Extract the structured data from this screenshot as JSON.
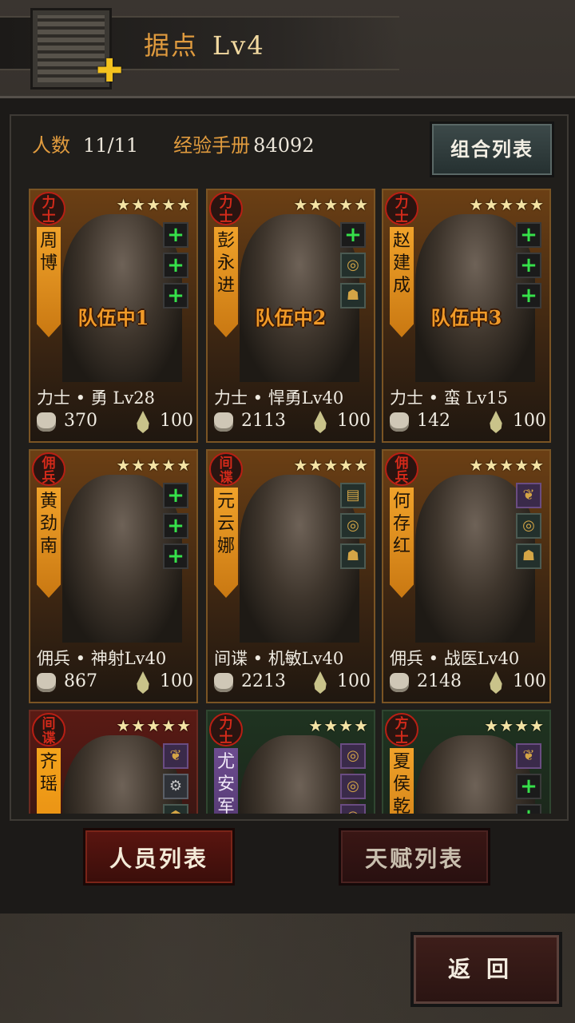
{
  "header": {
    "title": "据点",
    "level": "Lv4"
  },
  "stats": {
    "count_label": "人数",
    "count_value": "11/11",
    "exp_label": "经验手册",
    "exp_value": "84092"
  },
  "buttons": {
    "combo_list": "组合列表",
    "people_list": "人员列表",
    "talent_list": "天赋列表",
    "back": "返回"
  },
  "cards": [
    {
      "badge": "力士",
      "stars": "★★★★★",
      "name": "周博",
      "team": "队伍中1",
      "class_line": "力士 • 勇  Lv28",
      "power": "370",
      "stamina": "100",
      "slots": [
        "+",
        "+",
        "+"
      ]
    },
    {
      "badge": "力士",
      "stars": "★★★★★",
      "name": "彭永进",
      "team": "队伍中2",
      "class_line": "力士 • 悍勇Lv40",
      "power": "2113",
      "stamina": "100",
      "slots": [
        "+",
        "ring-item",
        "mask-item"
      ]
    },
    {
      "badge": "力士",
      "stars": "★★★★★",
      "name": "赵建成",
      "team": "队伍中3",
      "class_line": "力士 • 蛮  Lv15",
      "power": "142",
      "stamina": "100",
      "slots": [
        "+",
        "+",
        "+"
      ]
    },
    {
      "badge": "佣兵",
      "stars": "★★★★★",
      "name": "黄劲南",
      "team": "",
      "class_line": "佣兵 • 神射Lv40",
      "power": "867",
      "stamina": "100",
      "slots": [
        "+",
        "+",
        "+"
      ]
    },
    {
      "badge": "间谍",
      "stars": "★★★★★",
      "name": "元云娜",
      "team": "",
      "class_line": "间谍 • 机敏Lv40",
      "power": "2213",
      "stamina": "100",
      "slots": [
        "book-item",
        "ring-item",
        "mask-item"
      ]
    },
    {
      "badge": "佣兵",
      "stars": "★★★★★",
      "name": "何存红",
      "team": "",
      "class_line": "佣兵 • 战医Lv40",
      "power": "2148",
      "stamina": "100",
      "slots": [
        "herb-item",
        "ring-item",
        "mask-item"
      ]
    },
    {
      "badge": "间谍",
      "stars": "★★★★★",
      "name": "齐瑶",
      "team": "",
      "class_line": "",
      "power": "",
      "stamina": "",
      "slots": [
        "herb-item",
        "gear-item",
        "mask-item"
      ]
    },
    {
      "badge": "力士",
      "stars": "★★★★",
      "name": "尤安军",
      "team": "",
      "class_line": "",
      "power": "",
      "stamina": "",
      "slots": [
        "ring-item",
        "ring-item",
        "ring-item"
      ]
    },
    {
      "badge": "方士",
      "stars": "★★★★",
      "name": "夏侯乾",
      "team": "",
      "class_line": "",
      "power": "",
      "stamina": "",
      "slots": [
        "herb-item",
        "+",
        "+"
      ]
    }
  ]
}
